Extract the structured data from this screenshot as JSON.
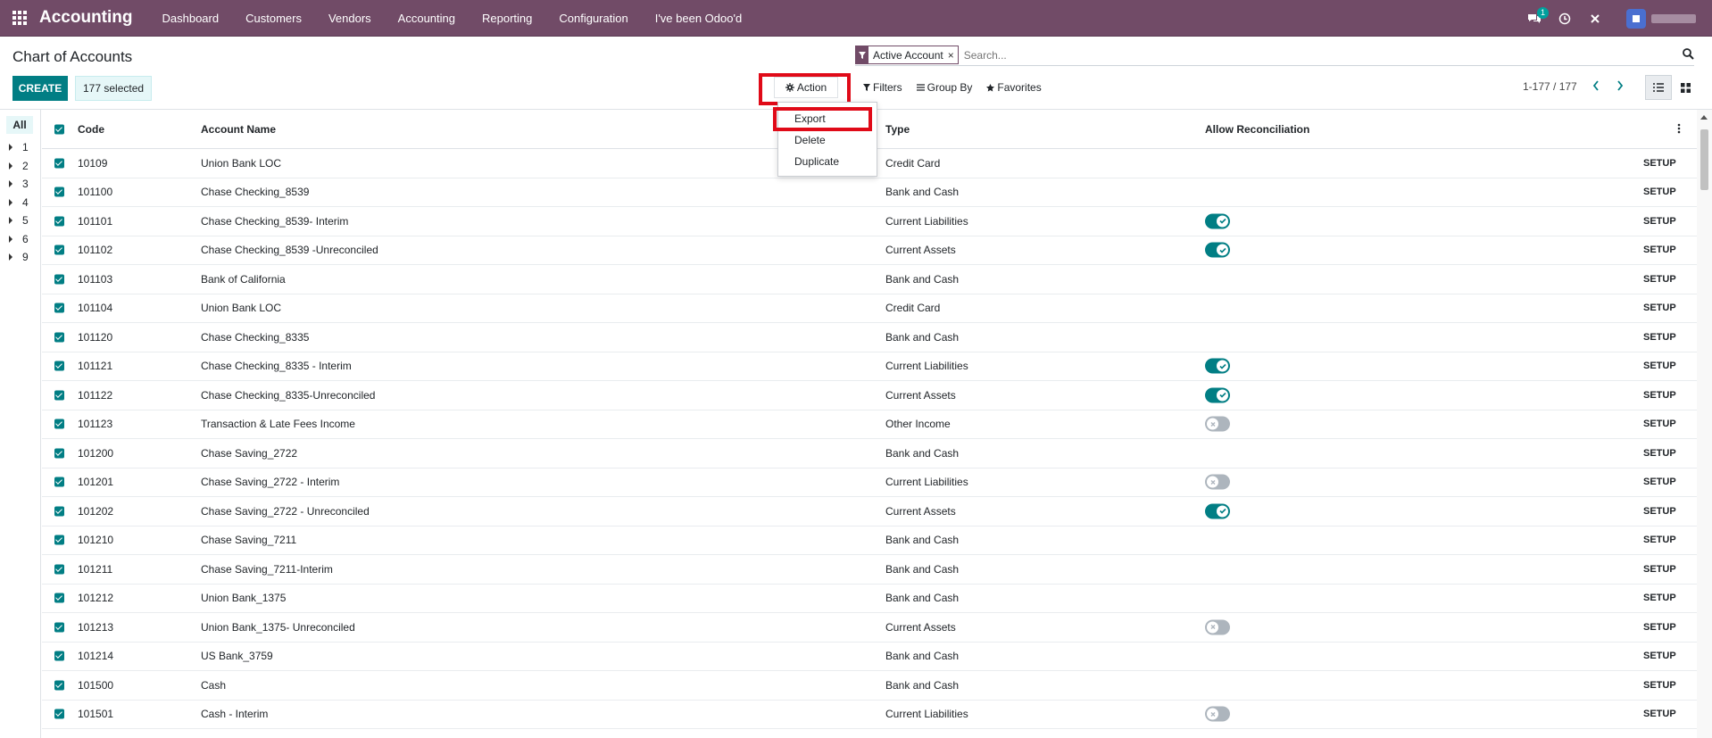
{
  "app": {
    "name": "Accounting",
    "menu": [
      "Dashboard",
      "Customers",
      "Vendors",
      "Accounting",
      "Reporting",
      "Configuration",
      "I've been Odoo'd"
    ],
    "chat_badge": "1",
    "accent_color": "#714b67",
    "primary_color": "#017e84"
  },
  "page": {
    "title": "Chart of Accounts",
    "create_label": "CREATE",
    "selected_label": "177 selected",
    "action_label": "Action",
    "filters_label": "Filters",
    "groupby_label": "Group By",
    "favorites_label": "Favorites",
    "pager": "1-177 / 177"
  },
  "search": {
    "facet": "Active Account",
    "placeholder": "Search..."
  },
  "action_menu": {
    "items": [
      "Export",
      "Delete",
      "Duplicate"
    ]
  },
  "sidebar": {
    "all_label": "All",
    "items": [
      "1",
      "2",
      "3",
      "4",
      "5",
      "6",
      "9"
    ]
  },
  "table": {
    "columns": {
      "code": "Code",
      "name": "Account Name",
      "type": "Type",
      "reconcile": "Allow Reconciliation"
    },
    "setup_label": "SETUP",
    "rows": [
      {
        "code": "10109",
        "name": "Union Bank LOC",
        "type": "Credit Card",
        "reconcile": "none"
      },
      {
        "code": "101100",
        "name": "Chase Checking_8539",
        "type": "Bank and Cash",
        "reconcile": "none"
      },
      {
        "code": "101101",
        "name": "Chase Checking_8539- Interim",
        "type": "Current Liabilities",
        "reconcile": "on"
      },
      {
        "code": "101102",
        "name": "Chase Checking_8539 -Unreconciled",
        "type": "Current Assets",
        "reconcile": "on"
      },
      {
        "code": "101103",
        "name": "Bank of California",
        "type": "Bank and Cash",
        "reconcile": "none"
      },
      {
        "code": "101104",
        "name": "Union Bank LOC",
        "type": "Credit Card",
        "reconcile": "none"
      },
      {
        "code": "101120",
        "name": "Chase Checking_8335",
        "type": "Bank and Cash",
        "reconcile": "none"
      },
      {
        "code": "101121",
        "name": "Chase Checking_8335 - Interim",
        "type": "Current Liabilities",
        "reconcile": "on"
      },
      {
        "code": "101122",
        "name": "Chase Checking_8335-Unreconciled",
        "type": "Current Assets",
        "reconcile": "on"
      },
      {
        "code": "101123",
        "name": "Transaction & Late Fees Income",
        "type": "Other Income",
        "reconcile": "off"
      },
      {
        "code": "101200",
        "name": "Chase Saving_2722",
        "type": "Bank and Cash",
        "reconcile": "none"
      },
      {
        "code": "101201",
        "name": "Chase Saving_2722 - Interim",
        "type": "Current Liabilities",
        "reconcile": "off"
      },
      {
        "code": "101202",
        "name": "Chase Saving_2722 - Unreconciled",
        "type": "Current Assets",
        "reconcile": "on"
      },
      {
        "code": "101210",
        "name": "Chase Saving_7211",
        "type": "Bank and Cash",
        "reconcile": "none"
      },
      {
        "code": "101211",
        "name": "Chase Saving_7211-Interim",
        "type": "Bank and Cash",
        "reconcile": "none"
      },
      {
        "code": "101212",
        "name": "Union Bank_1375",
        "type": "Bank and Cash",
        "reconcile": "none"
      },
      {
        "code": "101213",
        "name": "Union Bank_1375- Unreconciled",
        "type": "Current Assets",
        "reconcile": "off"
      },
      {
        "code": "101214",
        "name": "US Bank_3759",
        "type": "Bank and Cash",
        "reconcile": "none"
      },
      {
        "code": "101500",
        "name": "Cash",
        "type": "Bank and Cash",
        "reconcile": "none"
      },
      {
        "code": "101501",
        "name": "Cash - Interim",
        "type": "Current Liabilities",
        "reconcile": "off"
      }
    ]
  }
}
